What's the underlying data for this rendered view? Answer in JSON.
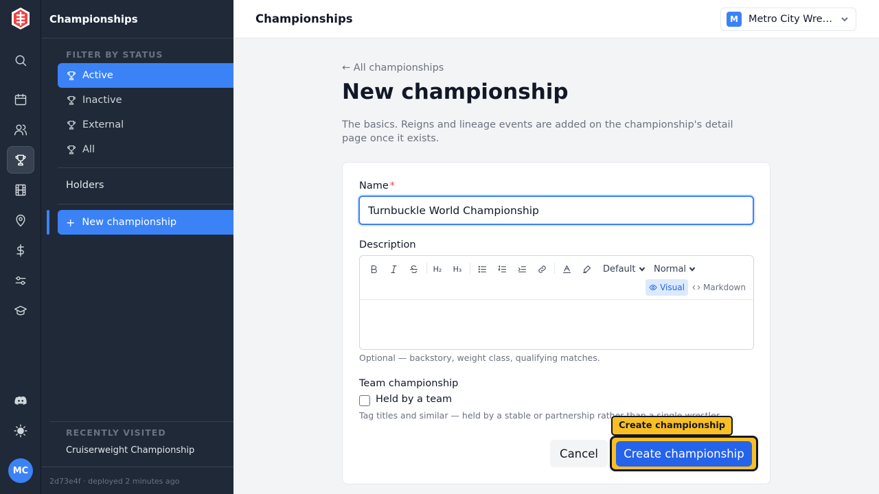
{
  "app": {
    "section_title": "Championships",
    "footer": "2d73e4f · deployed 2 minutes ago",
    "user_initials": "MC"
  },
  "rail": {
    "icons": [
      "search-icon",
      "calendar-icon",
      "users-icon",
      "trophy-icon",
      "film-icon",
      "map-pin-icon",
      "dollar-icon",
      "sliders-icon",
      "graduation-cap-icon",
      "discord-icon",
      "sun-icon"
    ],
    "active": "trophy-icon"
  },
  "sidebar": {
    "filter_label": "FILTER BY STATUS",
    "filters": [
      {
        "label": "Active",
        "selected": true
      },
      {
        "label": "Inactive",
        "selected": false
      },
      {
        "label": "External",
        "selected": false
      },
      {
        "label": "All",
        "selected": false
      }
    ],
    "holders": "Holders",
    "new_button": "New championship",
    "recent_label": "RECENTLY VISITED",
    "recent_items": [
      "Cruiserweight Championship"
    ]
  },
  "topbar": {
    "title": "Championships",
    "org_initial": "M",
    "org_name": "Metro City Wrestling"
  },
  "main": {
    "back_link": "← All championships",
    "title": "New championship",
    "description": "The basics. Reigns and lineage events are added on the championship's detail page once it exists."
  },
  "form": {
    "name_label": "Name",
    "required_mark": "*",
    "name_value": "Turnbuckle World Championship",
    "description_label": "Description",
    "font_select": "Default",
    "size_select": "Normal",
    "mode_visual": "Visual",
    "mode_markdown": "Markdown",
    "description_hint": "Optional — backstory, weight class, qualifying matches.",
    "team_label": "Team championship",
    "team_checkbox_label": "Held by a team",
    "team_checked": false,
    "team_hint": "Tag titles and similar — held by a stable or partnership rather than a single wrestler.",
    "cancel": "Cancel",
    "submit": "Create championship",
    "tooltip": "Create championship"
  },
  "colors": {
    "accent": "#3b82f6",
    "sidebar_bg": "#1f2937",
    "highlight": "#fbbf24"
  }
}
